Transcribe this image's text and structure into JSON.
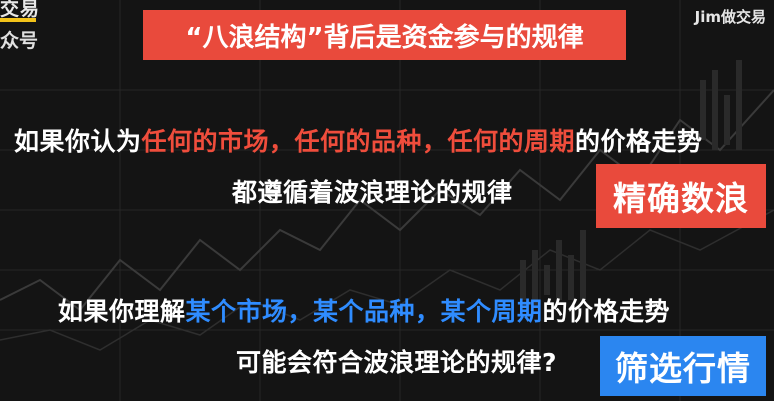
{
  "watermark_left": {
    "line1": "交易",
    "line2": "众号"
  },
  "watermark_right": "Jim做交易",
  "title": "“八浪结构”背后是资金参与的规律",
  "block1": {
    "prefix": "如果你认为",
    "highlight": "任何的市场，任何的品种，任何的周期",
    "suffix": "的价格走势",
    "line2": "都遵循着波浪理论的规律",
    "tag": "精确数浪",
    "tag_color": "#e94a3c"
  },
  "block2": {
    "prefix": "如果你理解",
    "highlight": "某个市场，某个品种，某个周期",
    "suffix": "的价格走势",
    "line2": "可能会符合波浪理论的规律?",
    "tag": "筛选行情",
    "tag_color": "#2b86f0"
  },
  "colors": {
    "accent_red": "#ef4d3c",
    "accent_blue": "#2f8cff",
    "background": "#141414",
    "logo_bar": "#f2c21a"
  }
}
